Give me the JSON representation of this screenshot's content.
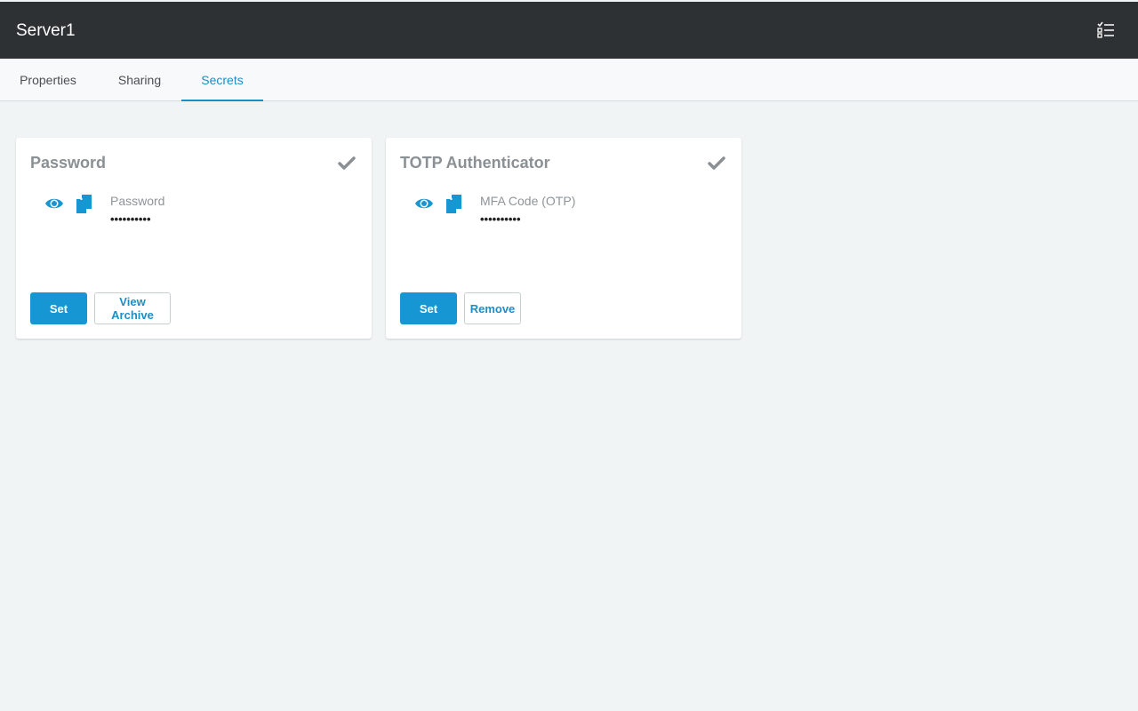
{
  "header": {
    "title": "Server1",
    "menu_icon": "checklist-icon"
  },
  "tabs": [
    {
      "label": "Properties",
      "active": false
    },
    {
      "label": "Sharing",
      "active": false
    },
    {
      "label": "Secrets",
      "active": true
    }
  ],
  "colors": {
    "header_bg": "#2e3133",
    "accent": "#1696d2",
    "page_bg": "#f1f4f5"
  },
  "cards": [
    {
      "title": "Password",
      "status_icon": "checkmark-icon",
      "field_label": "Password",
      "field_value": "••••••••••",
      "primary_button": "Set",
      "secondary_button": "View Archive"
    },
    {
      "title": "TOTP Authenticator",
      "status_icon": "checkmark-icon",
      "field_label": "MFA Code (OTP)",
      "field_value": "••••••••••",
      "primary_button": "Set",
      "secondary_button": "Remove"
    }
  ]
}
